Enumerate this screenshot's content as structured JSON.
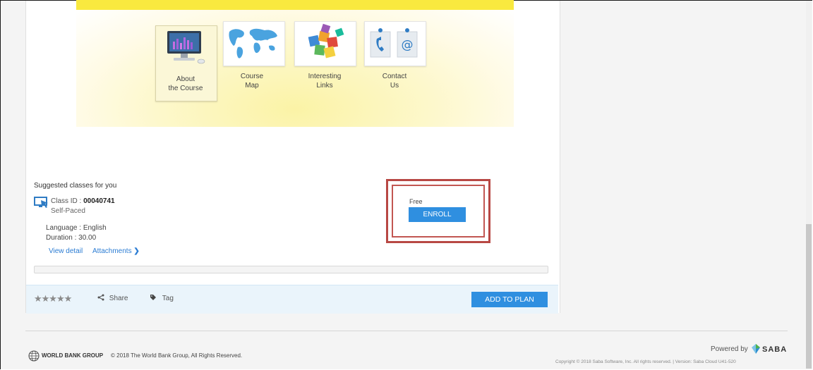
{
  "course_menu": {
    "tiles": [
      {
        "label": "About\nthe Course",
        "icon": "computer-monitor-icon",
        "active": true
      },
      {
        "label": "Course\nMap",
        "icon": "world-map-icon",
        "active": false
      },
      {
        "label": "Interesting\nLinks",
        "icon": "puzzle-cube-icon",
        "active": false
      },
      {
        "label": "Contact\nUs",
        "icon": "phone-email-icon",
        "active": false
      }
    ]
  },
  "suggested": {
    "title": "Suggested classes for you",
    "class_id_label": "Class ID : ",
    "class_id": "00040741",
    "mode": "Self-Paced",
    "language": "Language : English",
    "duration": "Duration : 30.00",
    "view_detail": "View detail",
    "attachments": "Attachments",
    "price": "Free",
    "enroll_label": "ENROLL"
  },
  "actions": {
    "stars": "★★★★★",
    "share_label": "Share",
    "tag_label": "Tag",
    "add_to_plan_label": "ADD TO PLAN"
  },
  "footer": {
    "org_name": "WORLD BANK GROUP",
    "copyright": "© 2018 The World Bank Group, All Rights Reserved.",
    "powered_by": "Powered by",
    "saba_brand": "SABA",
    "saba_copyright": "Copyright © 2018 Saba Software, Inc. All rights reserved.   |   Version: Saba Cloud U41-520"
  },
  "colors": {
    "accent_blue": "#2f8fe0",
    "banner_yellow": "#f9e93f",
    "highlight_red": "#b84844",
    "link_blue": "#2b7cd3"
  }
}
